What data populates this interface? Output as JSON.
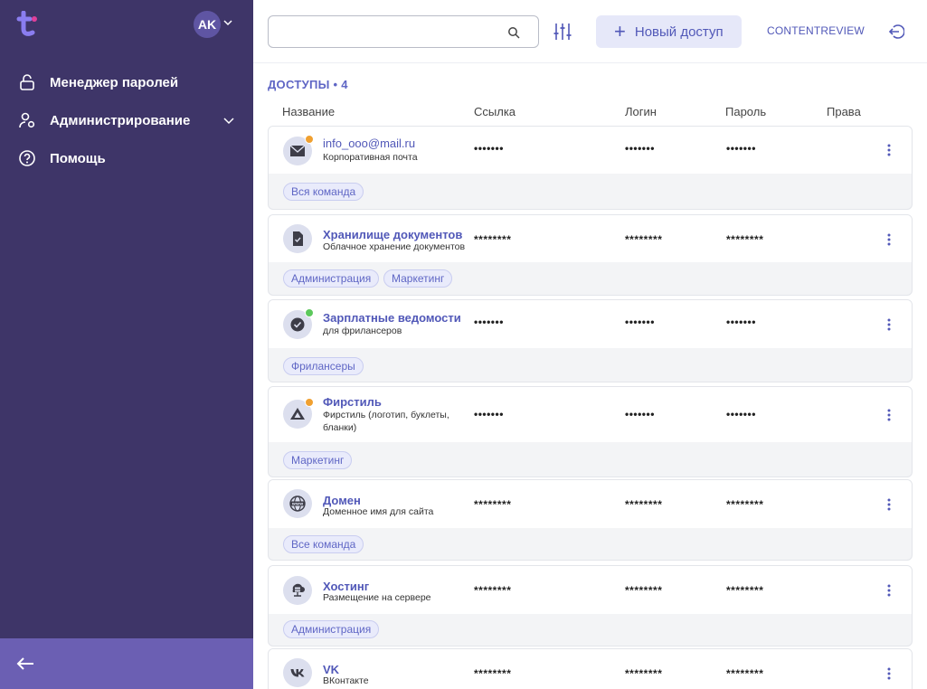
{
  "sidebar": {
    "avatar_initials": "AK",
    "nav": [
      {
        "label": "Менеджер паролей",
        "icon": "lock-icon"
      },
      {
        "label": "Администрирование",
        "icon": "user-gear-icon"
      },
      {
        "label": "Помощь",
        "icon": "help-icon"
      }
    ]
  },
  "topbar": {
    "search_value": "",
    "new_access_label": "Новый доступ",
    "company_label": "CONTENTREVIEW"
  },
  "list": {
    "section_title": "ДОСТУПЫ • 4",
    "columns": [
      "Название",
      "Ссылка",
      "Логин",
      "Пароль",
      "Права"
    ],
    "items": [
      {
        "title": "info_ooo@mail.ru",
        "subtitle": "Корпоративная почта",
        "link": "•••••••",
        "login": "•••••••",
        "password": "•••••••",
        "tags": [
          "Вся команда"
        ],
        "icon": "mail-icon",
        "status_color": "#f0a030"
      },
      {
        "title": "Хранилище документов",
        "subtitle": "Облачное хранение документов",
        "link": "********",
        "login": "********",
        "password": "********",
        "tags": [
          "Администрация",
          "Маркетинг"
        ],
        "icon": "document-icon"
      },
      {
        "title": "Зарплатные ведомости",
        "subtitle": "для фрилансеров",
        "link": "•••••••",
        "login": "•••••••",
        "password": "•••••••",
        "tags": [
          "Фрилансеры"
        ],
        "icon": "check-badge-icon",
        "status_color": "#5cc85c"
      },
      {
        "title": "Фирстиль",
        "subtitle": "Фирстиль (логотип, буклеты, бланки)",
        "link": "•••••••",
        "login": "•••••••",
        "password": "•••••••",
        "tags": [
          "Маркетинг"
        ],
        "icon": "drive-icon",
        "status_color": "#f0a030"
      },
      {
        "title": "Домен",
        "subtitle": "Доменное имя для сайта",
        "link": "********",
        "login": "********",
        "password": "********",
        "tags": [
          "Все команда"
        ],
        "icon": "www-icon"
      },
      {
        "title": "Хостинг",
        "subtitle": "Размещение на сервере",
        "link": "********",
        "login": "********",
        "password": "********",
        "tags": [
          "Администрация"
        ],
        "icon": "server-icon"
      },
      {
        "title": "VK",
        "subtitle": "ВКонтакте",
        "link": "********",
        "login": "********",
        "password": "********",
        "tags": [],
        "icon": "vk-icon"
      }
    ]
  },
  "colors": {
    "sidebar_bg": "#3e3568",
    "sidebar_footer": "#6b5fb3",
    "accent": "#5158b8",
    "tag_bg": "#e9ebfb"
  }
}
